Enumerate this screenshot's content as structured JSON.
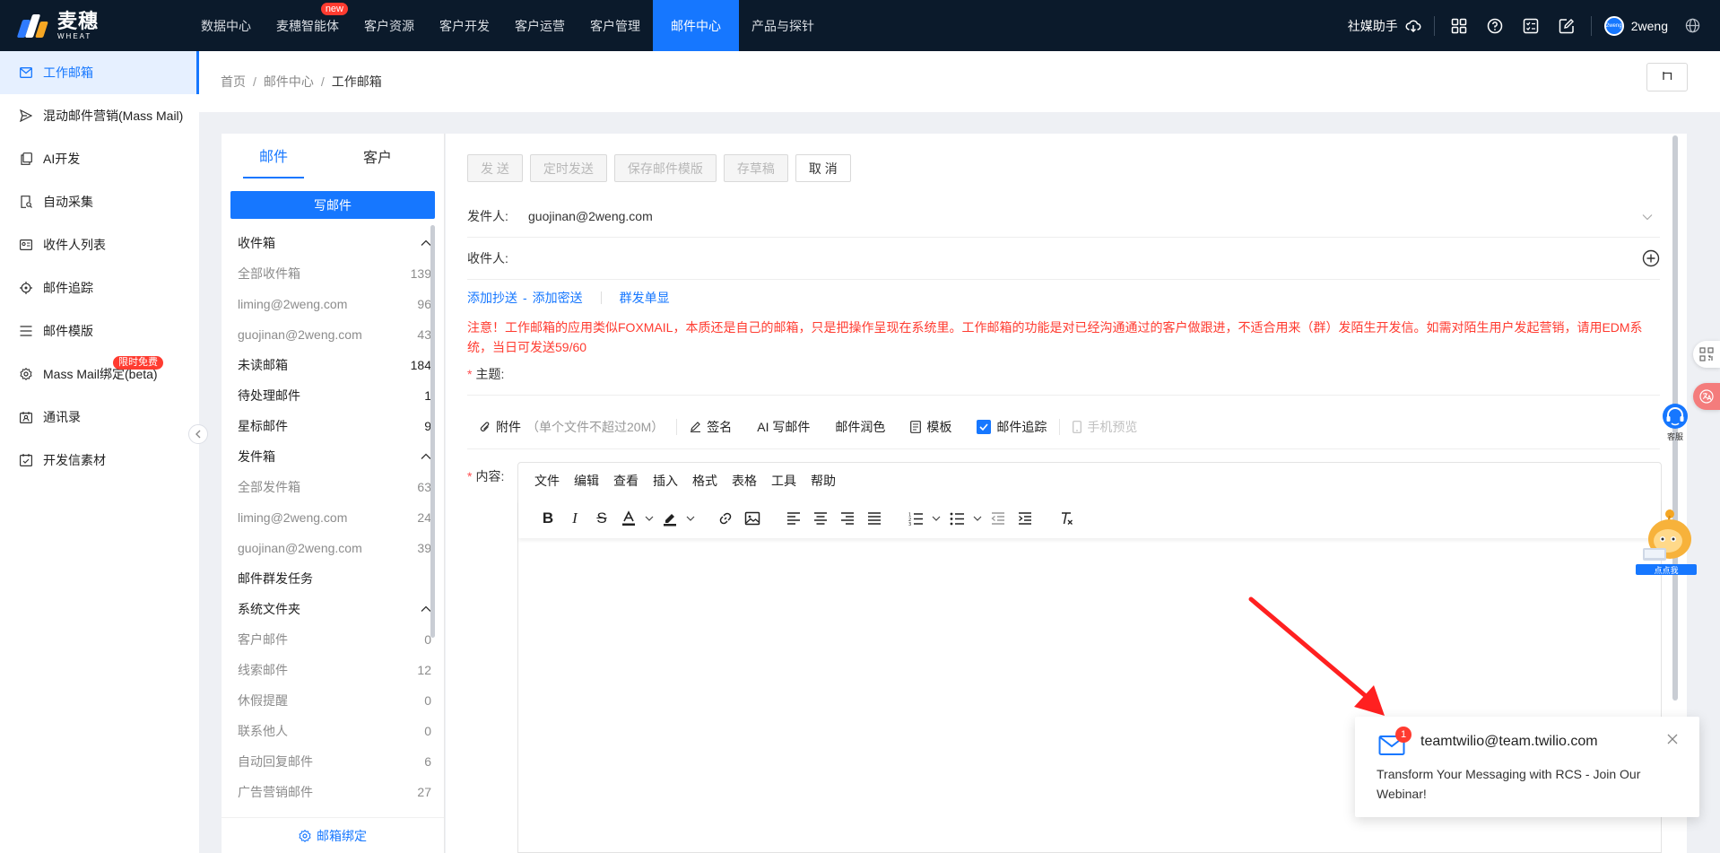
{
  "logo": {
    "cn": "麦穗",
    "en": "WHEAT"
  },
  "nav": {
    "items": [
      "数据中心",
      "麦穗智能体",
      "客户资源",
      "客户开发",
      "客户运营",
      "客户管理",
      "邮件中心",
      "产品与探针"
    ],
    "new_badge": "new"
  },
  "topright": {
    "assistant": "社媒助手",
    "username": "2weng",
    "avatar_text": "2weng"
  },
  "sidebar": {
    "items": [
      "工作邮箱",
      "混动邮件营销(Mass Mail)",
      "AI开发",
      "自动采集",
      "收件人列表",
      "邮件追踪",
      "邮件模版",
      "Mass Mail绑定(beta)",
      "通讯录",
      "开发信素材"
    ],
    "limit_badge": "限时免费"
  },
  "breadcrumb": {
    "home": "首页",
    "center": "邮件中心",
    "current": "工作邮箱",
    "sep": "/"
  },
  "folders": {
    "tabs": [
      "邮件",
      "客户"
    ],
    "compose": "写邮件",
    "inbox_head": "收件箱",
    "inbox_all": "全部收件箱",
    "inbox_all_count": "139",
    "inbox_a": "liming@2weng.com",
    "inbox_a_count": "96",
    "inbox_b": "guojinan@2weng.com",
    "inbox_b_count": "43",
    "unread": "未读邮箱",
    "unread_count": "184",
    "pending": "待处理邮件",
    "pending_count": "1",
    "starred": "星标邮件",
    "starred_count": "9",
    "sent_head": "发件箱",
    "sent_all": "全部发件箱",
    "sent_all_count": "63",
    "sent_a": "liming@2weng.com",
    "sent_a_count": "24",
    "sent_b": "guojinan@2weng.com",
    "sent_b_count": "39",
    "mass_task": "邮件群发任务",
    "system_head": "系统文件夹",
    "cust": "客户邮件",
    "cust_count": "0",
    "lead": "线索邮件",
    "lead_count": "12",
    "vacation": "休假提醒",
    "vacation_count": "0",
    "contact": "联系他人",
    "contact_count": "0",
    "autoreply": "自动回复邮件",
    "autoreply_count": "6",
    "ads": "广告营销邮件",
    "ads_count": "27",
    "bind": "邮箱绑定"
  },
  "compose": {
    "buttons": [
      "发 送",
      "定时发送",
      "保存邮件模版",
      "存草稿",
      "取 消"
    ],
    "from_label": "发件人:",
    "from_value": "guojinan@2weng.com",
    "to_label": "收件人:",
    "add_cc": "添加抄送",
    "dash": "-",
    "add_bcc": "添加密送",
    "single_send": "群发单显",
    "warning": "注意！工作邮箱的应用类似FOXMAIL，本质还是自己的邮箱，只是把操作呈现在系统里。工作邮箱的功能是对已经沟通通过的客户做跟进，不适合用来（群）发陌生开发信。如需对陌生用户发起营销，请用EDM系统，当日可发送59/60",
    "subject_label": "主题:",
    "attach": "附件",
    "attach_hint": "（单个文件不超过20M）",
    "signature": "签名",
    "ai_write": "AI 写邮件",
    "polish": "邮件润色",
    "template": "模板",
    "tracking": "邮件追踪",
    "mobile_preview": "手机预览",
    "content_label": "内容:",
    "req_mark": "*",
    "editor_menu": [
      "文件",
      "编辑",
      "查看",
      "插入",
      "格式",
      "表格",
      "工具",
      "帮助"
    ]
  },
  "floating": {
    "kefu": "客服",
    "mascot_label": "点点我"
  },
  "notification": {
    "count": "1",
    "from": "teamtwilio@team.twilio.com",
    "subject": "Transform Your Messaging with RCS - Join Our Webinar!"
  },
  "colors": {
    "primary": "#1677ff",
    "nav_bg": "#0b1a2b",
    "warning": "#ff3b30"
  }
}
